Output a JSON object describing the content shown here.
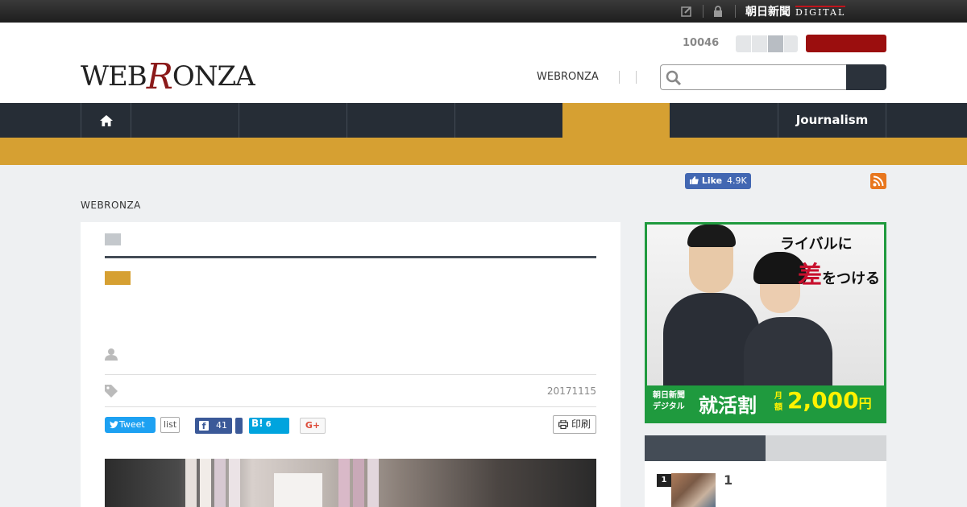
{
  "topbar": {
    "brand": "朝日新聞",
    "brand_digital": "DIGITAL"
  },
  "header": {
    "logo_pre": "WEB",
    "logo_r": "R",
    "logo_post": "ONZA",
    "count": "10046",
    "link": "WEBRONZA"
  },
  "nav": {
    "items": [
      "",
      "",
      "",
      "",
      "",
      "",
      "Journalism"
    ],
    "active_index": 5
  },
  "social": {
    "like_label": "Like",
    "like_count": "4.9K"
  },
  "breadcrumb": "WEBRONZA",
  "article": {
    "date": "20171115",
    "tweet_label": "Tweet",
    "list_label": "list",
    "fb_count": "41",
    "hatena_label": "B!",
    "hatena_count": "6",
    "gplus_label": "G+",
    "print_label": "印刷"
  },
  "ad": {
    "line1": "ライバルに",
    "line2_big": "差",
    "line2_rest": "をつける",
    "foot_small1": "朝日新聞",
    "foot_small2": "デジタル",
    "foot_main": "就活割",
    "foot_month1": "月",
    "foot_month2": "額",
    "price": "2,000",
    "yen": "円"
  },
  "ranking": {
    "num": "1",
    "title": "1"
  },
  "colors": {
    "nav_bg": "#262d36",
    "accent_gold": "#d6a032",
    "red_button": "#9b0e0e",
    "ad_green": "#1f9a3e"
  }
}
